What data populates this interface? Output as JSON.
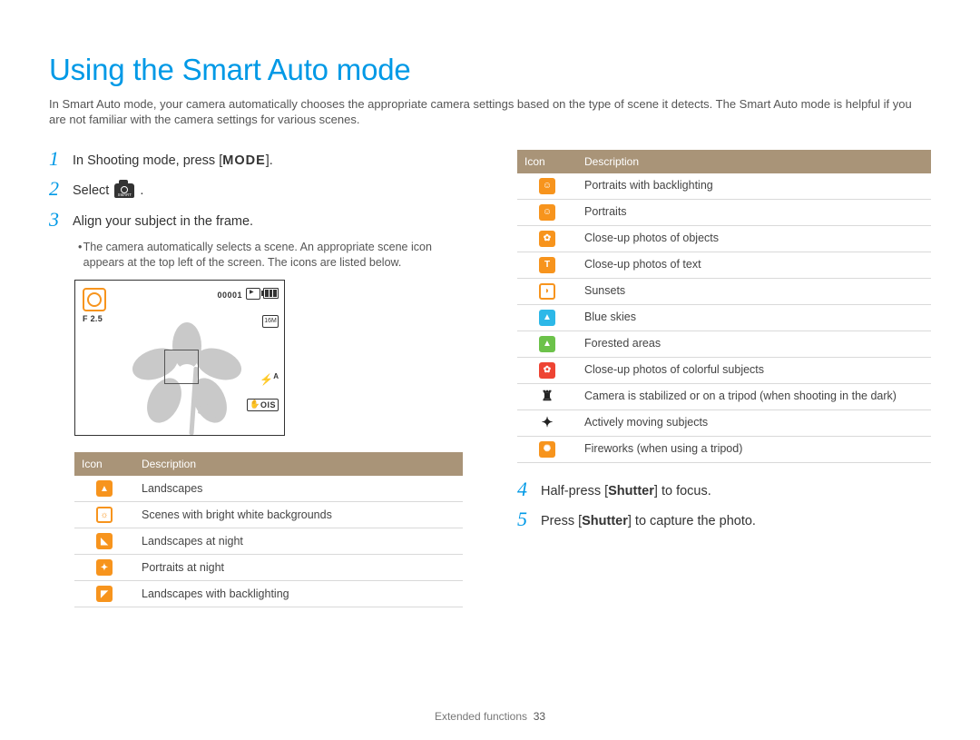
{
  "title": "Using the Smart Auto mode",
  "intro": "In Smart Auto mode, your camera automatically chooses the appropriate camera settings based on the type of scene it detects. The Smart Auto mode is helpful if you are not familiar with the camera settings for various scenes.",
  "steps": {
    "s1_pre": "In Shooting mode, press [",
    "s1_mode": "MODE",
    "s1_post": "].",
    "s2_pre": "Select ",
    "s2_post": " .",
    "s3": "Align your subject in the frame.",
    "s3_note": "The camera automatically selects a scene. An appropriate scene icon appears at the top left of the screen. The icons are listed below.",
    "s4_pre": "Half-press [",
    "s4_b": "Shutter",
    "s4_post": "] to focus.",
    "s5_pre": "Press [",
    "s5_b": "Shutter",
    "s5_post": "] to capture the photo."
  },
  "numbers": {
    "n1": "1",
    "n2": "2",
    "n3": "3",
    "n4": "4",
    "n5": "5"
  },
  "preview": {
    "fnumber": "F 2.5",
    "counter": "00001",
    "res": "16M",
    "flash_a": "A",
    "ois": "OIS"
  },
  "table_headers": {
    "icon": "Icon",
    "desc": "Description"
  },
  "table_left": [
    {
      "glyph": "▲",
      "cls": "solid",
      "desc": "Landscapes"
    },
    {
      "glyph": "☼",
      "cls": "outline",
      "desc": "Scenes with bright white backgrounds"
    },
    {
      "glyph": "◣",
      "cls": "solid",
      "desc": "Landscapes at night"
    },
    {
      "glyph": "✦",
      "cls": "solid",
      "desc": "Portraits at night"
    },
    {
      "glyph": "◤",
      "cls": "solid",
      "desc": "Landscapes with backlighting"
    }
  ],
  "table_right": [
    {
      "glyph": "☺",
      "cls": "solid",
      "desc": "Portraits with backlighting"
    },
    {
      "glyph": "☺",
      "cls": "solid",
      "desc": "Portraits"
    },
    {
      "glyph": "✿",
      "cls": "solid",
      "desc": "Close-up photos of objects"
    },
    {
      "glyph": "T",
      "cls": "solid",
      "desc": "Close-up photos of text"
    },
    {
      "glyph": "◗",
      "cls": "outline",
      "desc": "Sunsets"
    },
    {
      "glyph": "▲",
      "cls": "blue",
      "desc": "Blue skies"
    },
    {
      "glyph": "▲",
      "cls": "green",
      "desc": "Forested areas"
    },
    {
      "glyph": "✿",
      "cls": "red",
      "desc": "Close-up photos of colorful subjects"
    },
    {
      "glyph": "♜",
      "cls": "black",
      "desc": "Camera is stabilized or on a tripod (when shooting in the dark)"
    },
    {
      "glyph": "✦",
      "cls": "black",
      "desc": "Actively moving subjects"
    },
    {
      "glyph": "✺",
      "cls": "solid",
      "desc": "Fireworks (when using a tripod)"
    }
  ],
  "footer": {
    "section": "Extended functions",
    "page": "33"
  }
}
